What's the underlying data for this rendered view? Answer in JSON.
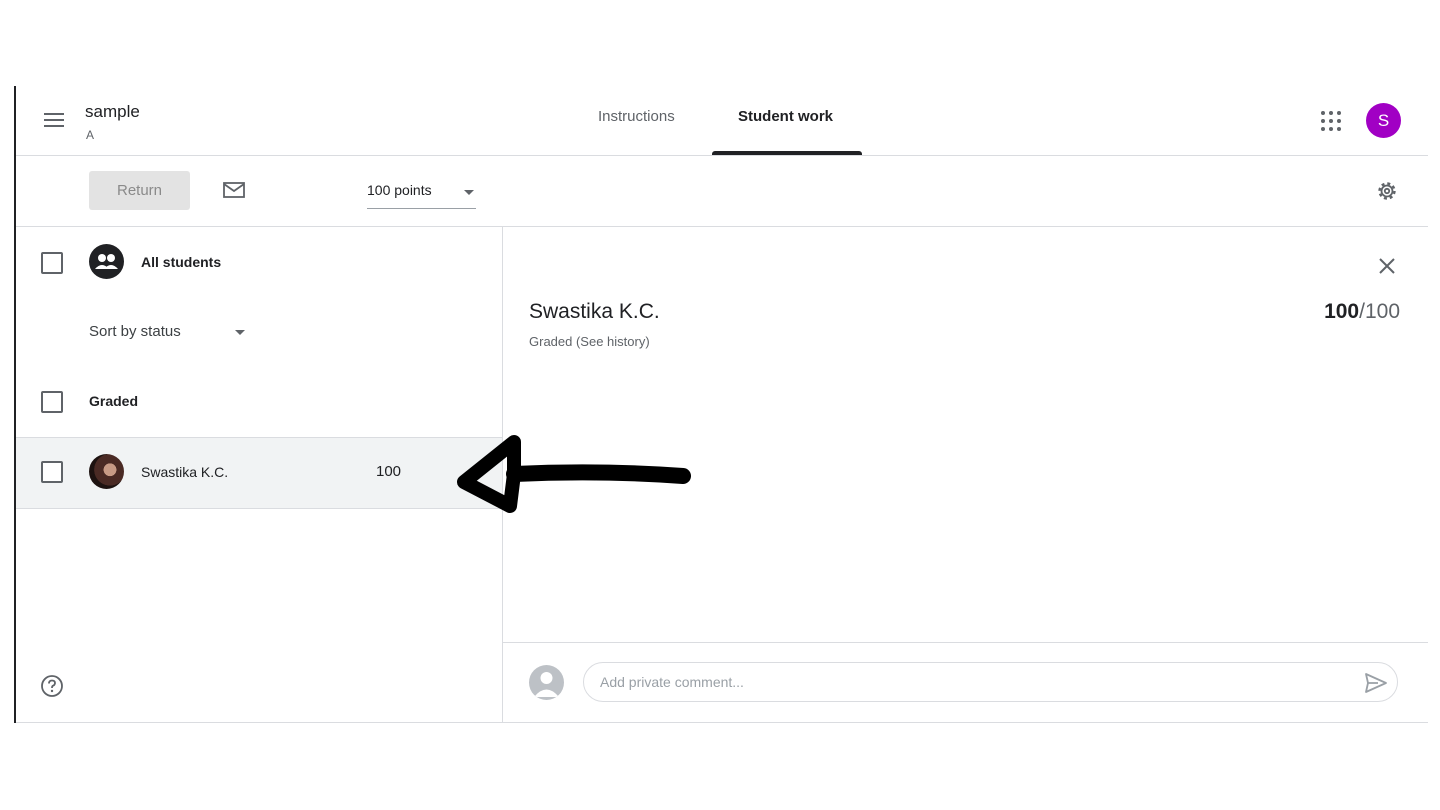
{
  "header": {
    "class_title": "sample",
    "class_section": "A",
    "tabs": [
      {
        "label": "Instructions",
        "active": false
      },
      {
        "label": "Student work",
        "active": true
      }
    ],
    "account_initial": "S",
    "account_color": "#a100c4"
  },
  "toolbar": {
    "return_label": "Return",
    "points_value": "100 points"
  },
  "left_panel": {
    "all_students_label": "All students",
    "sort_label": "Sort by status",
    "group_label": "Graded",
    "students": [
      {
        "name": "Swastika K.C.",
        "grade": "100"
      }
    ]
  },
  "detail": {
    "student_name": "Swastika K.C.",
    "status": "Graded (See history)",
    "score": "100",
    "score_total": "/100",
    "comment_placeholder": "Add private comment..."
  },
  "icons": [
    "menu-icon",
    "apps-grid-icon",
    "mail-icon",
    "gear-icon",
    "group-icon",
    "help-icon",
    "close-icon",
    "send-icon",
    "arrow-annotation"
  ]
}
